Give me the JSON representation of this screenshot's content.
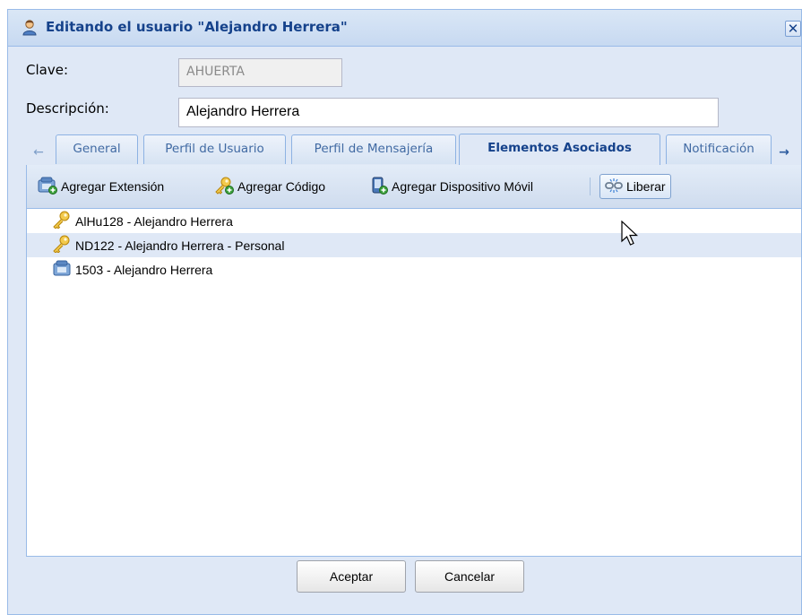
{
  "window": {
    "title": "Editando el usuario \"Alejandro Herrera\"",
    "icon": "user-icon",
    "close_label": "✕"
  },
  "form": {
    "clave_label": "Clave:",
    "clave_value": "AHUERTA",
    "descripcion_label": "Descripción:",
    "descripcion_value": "Alejandro Herrera"
  },
  "tabs": {
    "scroll_left": "←",
    "scroll_right": "→",
    "items": [
      {
        "label": "General",
        "active": false
      },
      {
        "label": "Perfil de Usuario",
        "active": false
      },
      {
        "label": "Perfil de Mensajería",
        "active": false
      },
      {
        "label": "Elementos Asociados",
        "active": true
      },
      {
        "label": "Notificación",
        "active": false
      }
    ]
  },
  "toolbar": {
    "add_extension": "Agregar Extensión",
    "add_code": "Agregar Código",
    "add_device": "Agregar Dispositivo Móvil",
    "release": "Liberar"
  },
  "list": {
    "items": [
      {
        "label": "AlHu128 - Alejandro Herrera",
        "icon": "key-icon",
        "selected": false
      },
      {
        "label": "ND122 - Alejandro Herrera - Personal",
        "icon": "key-icon",
        "selected": true
      },
      {
        "label": "1503 - Alejandro Herrera",
        "icon": "phone-icon",
        "selected": false
      }
    ]
  },
  "footer": {
    "accept": "Aceptar",
    "cancel": "Cancelar"
  },
  "colors": {
    "window_bg": "#dfe8f6",
    "border": "#99bbe8",
    "title_text": "#15428b",
    "selected_row": "#dfe8f6"
  }
}
